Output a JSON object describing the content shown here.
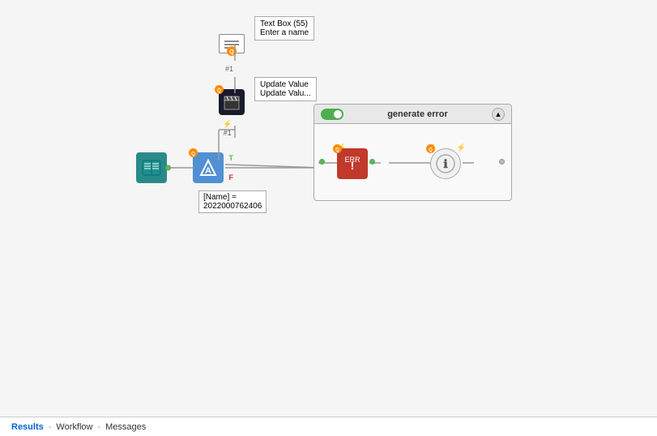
{
  "canvas": {
    "background": "#f5f5f5"
  },
  "textbox_tooltip": {
    "line1": "Text Box (55)",
    "line2": "Enter a name"
  },
  "update_tooltip": {
    "line1": "Update Value",
    "line2": "Update Valu..."
  },
  "generate_error": {
    "title": "generate error",
    "toggle_state": "on",
    "collapsed": false
  },
  "value_label": {
    "text": "[Name] =\n2022000762406"
  },
  "bottom_bar": {
    "items": [
      "Results",
      "Workflow",
      "Messages"
    ],
    "active": "Results",
    "separator": " - "
  }
}
